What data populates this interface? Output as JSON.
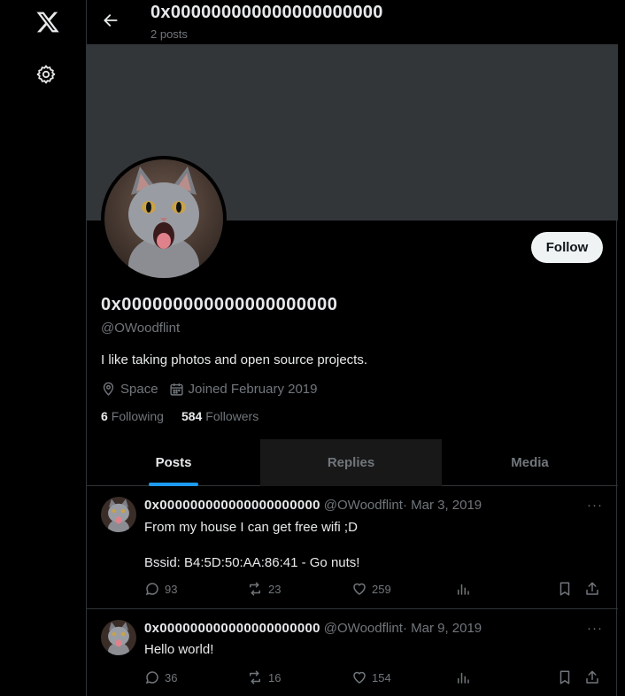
{
  "app": {
    "logo_icon": "x-logo-icon",
    "settings_icon": "gear-icon"
  },
  "header": {
    "title": "0x000000000000000000000",
    "post_count": "2 posts"
  },
  "profile": {
    "name": "0x000000000000000000000",
    "handle": "@OWoodflint",
    "bio": "I like taking photos and open source projects.",
    "location": "Space",
    "joined": "Joined February 2019",
    "following_count": "6",
    "following_label": "Following",
    "followers_count": "584",
    "followers_label": "Followers",
    "follow_button": "Follow",
    "banner_color": "#333639"
  },
  "tabs": [
    {
      "label": "Posts",
      "active": true
    },
    {
      "label": "Replies",
      "active": false
    },
    {
      "label": "Media",
      "active": false
    }
  ],
  "posts": [
    {
      "name": "0x000000000000000000000",
      "handle": "@OWoodflint",
      "date": " · Mar 3, 2019",
      "text": "From my house I can get free wifi ;D\n\nBssid: B4:5D:50:AA:86:41 - Go nuts!",
      "replies": "93",
      "reposts": "23",
      "likes": "259"
    },
    {
      "name": "0x000000000000000000000",
      "handle": "@OWoodflint",
      "date": " · Mar 9, 2019",
      "text": "Hello world!",
      "replies": "36",
      "reposts": "16",
      "likes": "154"
    }
  ],
  "more_glyph": "···",
  "colors": {
    "accent": "#1d9bf0",
    "background": "#000000",
    "muted": "#71767b",
    "text": "#e7e9ea"
  }
}
